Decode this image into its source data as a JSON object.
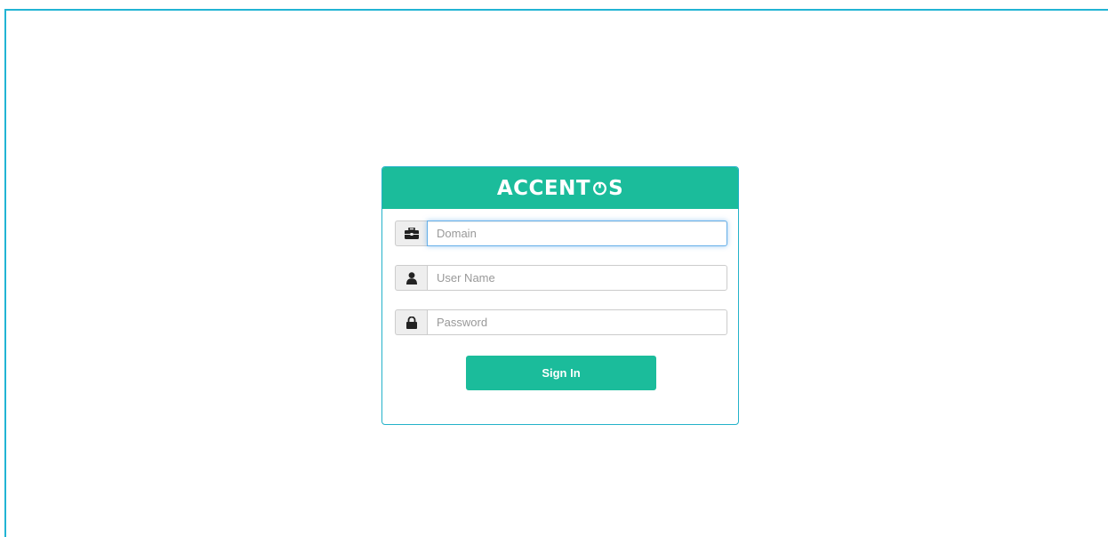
{
  "brand": {
    "logo_text_left": "ACCENT",
    "logo_text_right": "S",
    "header_color": "#1bbc9b"
  },
  "form": {
    "domain": {
      "placeholder": "Domain",
      "icon": "briefcase-icon"
    },
    "username": {
      "placeholder": "User Name",
      "icon": "user-icon"
    },
    "password": {
      "placeholder": "Password",
      "icon": "lock-icon"
    },
    "sign_in_label": "Sign In"
  },
  "colors": {
    "accent": "#1bbc9b",
    "frame_border": "#22b4d4",
    "focus_border": "#66afe9"
  }
}
